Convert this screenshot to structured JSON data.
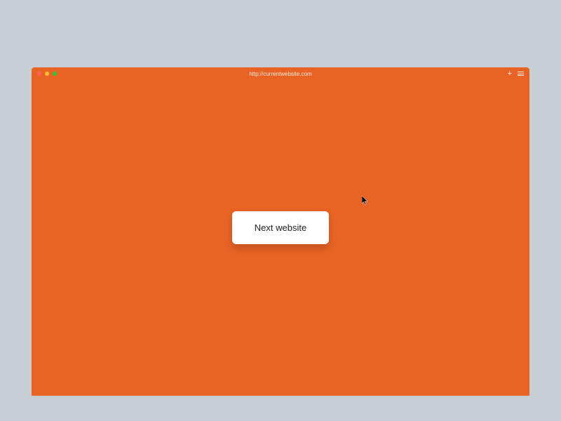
{
  "titlebar": {
    "url": "http://currentwebsite.com"
  },
  "content": {
    "button_label": "Next website"
  },
  "colors": {
    "page_bg": "#c7cfd4",
    "window_bg": "#e96424"
  }
}
